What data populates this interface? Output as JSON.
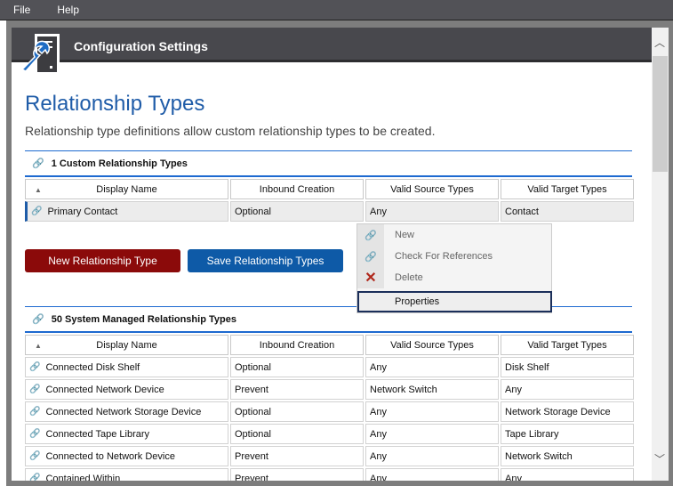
{
  "menu": [
    "File",
    "Help"
  ],
  "header": {
    "title": "Configuration Settings"
  },
  "page": {
    "title": "Relationship Types",
    "description": "Relationship type definitions allow custom relationship types to be created."
  },
  "columns": [
    "Display Name",
    "Inbound Creation",
    "Valid Source Types",
    "Valid Target Types"
  ],
  "custom": {
    "heading": "1 Custom Relationship Types",
    "rows": [
      [
        "Primary Contact",
        "Optional",
        "Any",
        "Contact"
      ]
    ]
  },
  "buttons": {
    "new": "New Relationship Type",
    "save": "Save Relationship Types"
  },
  "context_menu": {
    "items": [
      "New",
      "Check For References",
      "Delete"
    ],
    "properties": "Properties"
  },
  "system": {
    "heading": "50 System Managed Relationship Types",
    "rows": [
      [
        "Connected Disk Shelf",
        "Optional",
        "Any",
        "Disk Shelf"
      ],
      [
        "Connected Network Device",
        "Prevent",
        "Network Switch",
        "Any"
      ],
      [
        "Connected Network Storage Device",
        "Optional",
        "Any",
        "Network Storage Device"
      ],
      [
        "Connected Tape Library",
        "Optional",
        "Any",
        "Tape Library"
      ],
      [
        "Connected to Network Device",
        "Prevent",
        "Any",
        "Network Switch"
      ],
      [
        "Contained Within",
        "Prevent",
        "Any",
        "Any"
      ]
    ]
  },
  "colors": {
    "accent": "#1e6ad0",
    "new_button": "#8b0a0a",
    "save_button": "#0e5aa7"
  }
}
